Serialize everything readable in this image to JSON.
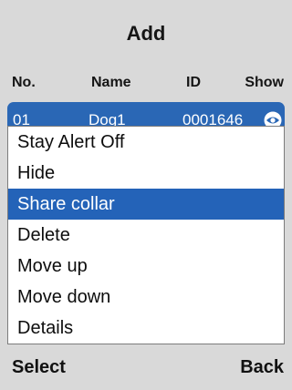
{
  "screen_title": "Add",
  "table_header": {
    "no": "No.",
    "name": "Name",
    "id": "ID",
    "show": "Show"
  },
  "selected_row": {
    "no": "01",
    "name": "Dog1",
    "id": "0001646",
    "show_icon": "eye-icon"
  },
  "context_menu": {
    "items": [
      {
        "label": "Stay Alert Off"
      },
      {
        "label": "Hide"
      },
      {
        "label": "Share collar",
        "active": true
      },
      {
        "label": "Delete"
      },
      {
        "label": "Move up"
      },
      {
        "label": "Move down"
      },
      {
        "label": "Details"
      }
    ]
  },
  "softkeys": {
    "left": "Select",
    "right": "Back"
  },
  "colors": {
    "background": "#d9d9d9",
    "accent": "#2463b8",
    "menu_background": "#ffffff"
  }
}
